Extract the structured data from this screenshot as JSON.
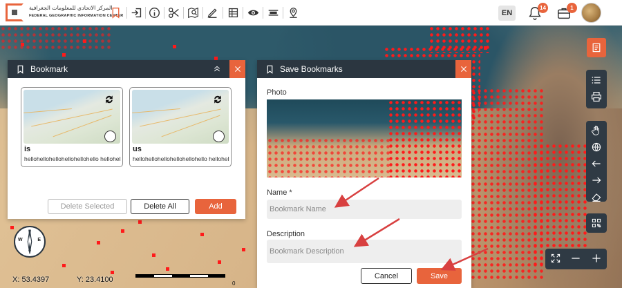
{
  "header": {
    "logo_ar": "المركز الاتحادي للمعلومات الجغرافية",
    "logo_en": "FEDERAL GEOGRAPHIC INFORMATION CENTER",
    "language": "EN",
    "notifications_count": "14",
    "messages_count": "1",
    "toolbar_icons": [
      "bookmark-icon",
      "login-icon",
      "info-icon",
      "scissors-icon",
      "map-search-icon",
      "draw-icon",
      "table-icon",
      "eye-icon",
      "layout-icon",
      "location-pin-icon"
    ]
  },
  "bookmark_panel": {
    "title": "Bookmark",
    "bookmarks": [
      {
        "name": "is",
        "description": "hellohellohellohellohellohello hellohellohell"
      },
      {
        "name": "us",
        "description": "hellohellohellohellohellohello hellohellohell"
      }
    ],
    "delete_selected_label": "Delete Selected",
    "delete_all_label": "Delete All",
    "add_label": "Add"
  },
  "save_panel": {
    "title": "Save Bookmarks",
    "photo_label": "Photo",
    "name_label": "Name *",
    "name_placeholder": "Bookmark Name",
    "description_label": "Description",
    "description_placeholder": "Bookmark Description",
    "cancel_label": "Cancel",
    "save_label": "Save"
  },
  "map": {
    "x_coord": "X: 53.4397",
    "y_coord": "Y: 23.4100",
    "scale_zero": "0",
    "compass_w": "W",
    "compass_e": "E"
  },
  "colors": {
    "accent": "#e8643c",
    "panel_header": "#2b3640",
    "feature": "#ff1a1a"
  }
}
